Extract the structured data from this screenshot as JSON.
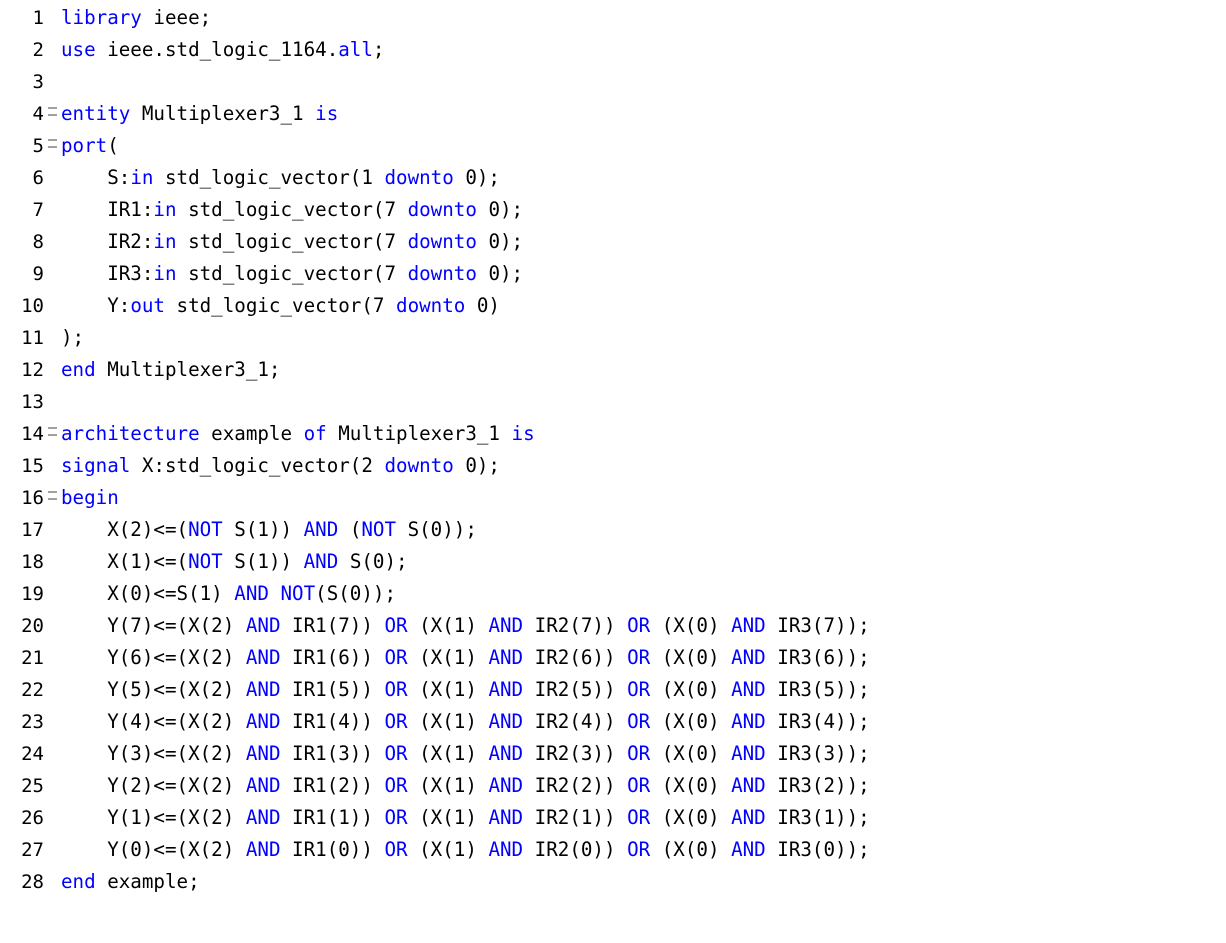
{
  "colors": {
    "keyword": "#0000ff",
    "plain": "#000000",
    "fold_marker": "#a0a0a0",
    "background": "#ffffff"
  },
  "lines": [
    {
      "num": "1",
      "fold": false,
      "tokens": [
        [
          "k",
          "library"
        ],
        [
          "p",
          " ieee;"
        ]
      ]
    },
    {
      "num": "2",
      "fold": false,
      "tokens": [
        [
          "k",
          "use"
        ],
        [
          "p",
          " ieee.std_logic_1164."
        ],
        [
          "k",
          "all"
        ],
        [
          "p",
          ";"
        ]
      ]
    },
    {
      "num": "3",
      "fold": false,
      "tokens": []
    },
    {
      "num": "4",
      "fold": true,
      "tokens": [
        [
          "k",
          "entity"
        ],
        [
          "p",
          " Multiplexer3_1 "
        ],
        [
          "k",
          "is"
        ]
      ]
    },
    {
      "num": "5",
      "fold": true,
      "tokens": [
        [
          "k",
          "port"
        ],
        [
          "p",
          "("
        ]
      ]
    },
    {
      "num": "6",
      "fold": false,
      "tokens": [
        [
          "p",
          "    S:"
        ],
        [
          "k",
          "in"
        ],
        [
          "p",
          " std_logic_vector(1 "
        ],
        [
          "k",
          "downto"
        ],
        [
          "p",
          " 0);"
        ]
      ]
    },
    {
      "num": "7",
      "fold": false,
      "tokens": [
        [
          "p",
          "    IR1:"
        ],
        [
          "k",
          "in"
        ],
        [
          "p",
          " std_logic_vector(7 "
        ],
        [
          "k",
          "downto"
        ],
        [
          "p",
          " 0);"
        ]
      ]
    },
    {
      "num": "8",
      "fold": false,
      "tokens": [
        [
          "p",
          "    IR2:"
        ],
        [
          "k",
          "in"
        ],
        [
          "p",
          " std_logic_vector(7 "
        ],
        [
          "k",
          "downto"
        ],
        [
          "p",
          " 0);"
        ]
      ]
    },
    {
      "num": "9",
      "fold": false,
      "tokens": [
        [
          "p",
          "    IR3:"
        ],
        [
          "k",
          "in"
        ],
        [
          "p",
          " std_logic_vector(7 "
        ],
        [
          "k",
          "downto"
        ],
        [
          "p",
          " 0);"
        ]
      ]
    },
    {
      "num": "10",
      "fold": false,
      "tokens": [
        [
          "p",
          "    Y:"
        ],
        [
          "k",
          "out"
        ],
        [
          "p",
          " std_logic_vector(7 "
        ],
        [
          "k",
          "downto"
        ],
        [
          "p",
          " 0)"
        ]
      ]
    },
    {
      "num": "11",
      "fold": false,
      "tokens": [
        [
          "p",
          ");"
        ]
      ]
    },
    {
      "num": "12",
      "fold": false,
      "tokens": [
        [
          "k",
          "end"
        ],
        [
          "p",
          " Multiplexer3_1;"
        ]
      ]
    },
    {
      "num": "13",
      "fold": false,
      "tokens": []
    },
    {
      "num": "14",
      "fold": true,
      "tokens": [
        [
          "k",
          "architecture"
        ],
        [
          "p",
          " example "
        ],
        [
          "k",
          "of"
        ],
        [
          "p",
          " Multiplexer3_1 "
        ],
        [
          "k",
          "is"
        ]
      ]
    },
    {
      "num": "15",
      "fold": false,
      "tokens": [
        [
          "k",
          "signal"
        ],
        [
          "p",
          " X:std_logic_vector(2 "
        ],
        [
          "k",
          "downto"
        ],
        [
          "p",
          " 0);"
        ]
      ]
    },
    {
      "num": "16",
      "fold": true,
      "tokens": [
        [
          "k",
          "begin"
        ]
      ]
    },
    {
      "num": "17",
      "fold": false,
      "tokens": [
        [
          "p",
          "    X(2)<=("
        ],
        [
          "k",
          "NOT"
        ],
        [
          "p",
          " S(1)) "
        ],
        [
          "k",
          "AND"
        ],
        [
          "p",
          " ("
        ],
        [
          "k",
          "NOT"
        ],
        [
          "p",
          " S(0));"
        ]
      ]
    },
    {
      "num": "18",
      "fold": false,
      "tokens": [
        [
          "p",
          "    X(1)<=("
        ],
        [
          "k",
          "NOT"
        ],
        [
          "p",
          " S(1)) "
        ],
        [
          "k",
          "AND"
        ],
        [
          "p",
          " S(0);"
        ]
      ]
    },
    {
      "num": "19",
      "fold": false,
      "tokens": [
        [
          "p",
          "    X(0)<=S(1) "
        ],
        [
          "k",
          "AND"
        ],
        [
          "p",
          " "
        ],
        [
          "k",
          "NOT"
        ],
        [
          "p",
          "(S(0));"
        ]
      ]
    },
    {
      "num": "20",
      "fold": false,
      "tokens": [
        [
          "p",
          "    Y(7)<=(X(2) "
        ],
        [
          "k",
          "AND"
        ],
        [
          "p",
          " IR1(7)) "
        ],
        [
          "k",
          "OR"
        ],
        [
          "p",
          " (X(1) "
        ],
        [
          "k",
          "AND"
        ],
        [
          "p",
          " IR2(7)) "
        ],
        [
          "k",
          "OR"
        ],
        [
          "p",
          " (X(0) "
        ],
        [
          "k",
          "AND"
        ],
        [
          "p",
          " IR3(7));"
        ]
      ]
    },
    {
      "num": "21",
      "fold": false,
      "tokens": [
        [
          "p",
          "    Y(6)<=(X(2) "
        ],
        [
          "k",
          "AND"
        ],
        [
          "p",
          " IR1(6)) "
        ],
        [
          "k",
          "OR"
        ],
        [
          "p",
          " (X(1) "
        ],
        [
          "k",
          "AND"
        ],
        [
          "p",
          " IR2(6)) "
        ],
        [
          "k",
          "OR"
        ],
        [
          "p",
          " (X(0) "
        ],
        [
          "k",
          "AND"
        ],
        [
          "p",
          " IR3(6));"
        ]
      ]
    },
    {
      "num": "22",
      "fold": false,
      "tokens": [
        [
          "p",
          "    Y(5)<=(X(2) "
        ],
        [
          "k",
          "AND"
        ],
        [
          "p",
          " IR1(5)) "
        ],
        [
          "k",
          "OR"
        ],
        [
          "p",
          " (X(1) "
        ],
        [
          "k",
          "AND"
        ],
        [
          "p",
          " IR2(5)) "
        ],
        [
          "k",
          "OR"
        ],
        [
          "p",
          " (X(0) "
        ],
        [
          "k",
          "AND"
        ],
        [
          "p",
          " IR3(5));"
        ]
      ]
    },
    {
      "num": "23",
      "fold": false,
      "tokens": [
        [
          "p",
          "    Y(4)<=(X(2) "
        ],
        [
          "k",
          "AND"
        ],
        [
          "p",
          " IR1(4)) "
        ],
        [
          "k",
          "OR"
        ],
        [
          "p",
          " (X(1) "
        ],
        [
          "k",
          "AND"
        ],
        [
          "p",
          " IR2(4)) "
        ],
        [
          "k",
          "OR"
        ],
        [
          "p",
          " (X(0) "
        ],
        [
          "k",
          "AND"
        ],
        [
          "p",
          " IR3(4));"
        ]
      ]
    },
    {
      "num": "24",
      "fold": false,
      "tokens": [
        [
          "p",
          "    Y(3)<=(X(2) "
        ],
        [
          "k",
          "AND"
        ],
        [
          "p",
          " IR1(3)) "
        ],
        [
          "k",
          "OR"
        ],
        [
          "p",
          " (X(1) "
        ],
        [
          "k",
          "AND"
        ],
        [
          "p",
          " IR2(3)) "
        ],
        [
          "k",
          "OR"
        ],
        [
          "p",
          " (X(0) "
        ],
        [
          "k",
          "AND"
        ],
        [
          "p",
          " IR3(3));"
        ]
      ]
    },
    {
      "num": "25",
      "fold": false,
      "tokens": [
        [
          "p",
          "    Y(2)<=(X(2) "
        ],
        [
          "k",
          "AND"
        ],
        [
          "p",
          " IR1(2)) "
        ],
        [
          "k",
          "OR"
        ],
        [
          "p",
          " (X(1) "
        ],
        [
          "k",
          "AND"
        ],
        [
          "p",
          " IR2(2)) "
        ],
        [
          "k",
          "OR"
        ],
        [
          "p",
          " (X(0) "
        ],
        [
          "k",
          "AND"
        ],
        [
          "p",
          " IR3(2));"
        ]
      ]
    },
    {
      "num": "26",
      "fold": false,
      "tokens": [
        [
          "p",
          "    Y(1)<=(X(2) "
        ],
        [
          "k",
          "AND"
        ],
        [
          "p",
          " IR1(1)) "
        ],
        [
          "k",
          "OR"
        ],
        [
          "p",
          " (X(1) "
        ],
        [
          "k",
          "AND"
        ],
        [
          "p",
          " IR2(1)) "
        ],
        [
          "k",
          "OR"
        ],
        [
          "p",
          " (X(0) "
        ],
        [
          "k",
          "AND"
        ],
        [
          "p",
          " IR3(1));"
        ]
      ]
    },
    {
      "num": "27",
      "fold": false,
      "tokens": [
        [
          "p",
          "    Y(0)<=(X(2) "
        ],
        [
          "k",
          "AND"
        ],
        [
          "p",
          " IR1(0)) "
        ],
        [
          "k",
          "OR"
        ],
        [
          "p",
          " (X(1) "
        ],
        [
          "k",
          "AND"
        ],
        [
          "p",
          " IR2(0)) "
        ],
        [
          "k",
          "OR"
        ],
        [
          "p",
          " (X(0) "
        ],
        [
          "k",
          "AND"
        ],
        [
          "p",
          " IR3(0));"
        ]
      ]
    },
    {
      "num": "28",
      "fold": false,
      "tokens": [
        [
          "k",
          "end"
        ],
        [
          "p",
          " example;"
        ]
      ]
    }
  ]
}
